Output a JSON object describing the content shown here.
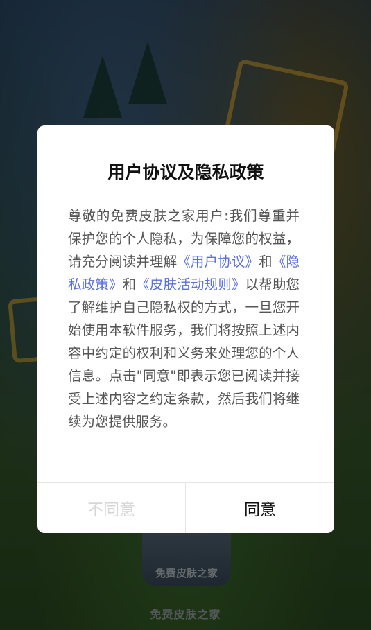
{
  "dialog": {
    "title": "用户协议及隐私政策",
    "body_parts": [
      "尊敬的免费皮肤之家用户:我们尊重并保护您的个人隐私，为保障您的权益，请充分阅读并理解",
      "《用户协议》",
      "和",
      "《隐私政策》",
      "和",
      "《皮肤活动规则》",
      "以帮助您了解维护自己隐私权的方式，一旦您开始使用本软件服务，我们将按照上述内容中约定的权利和义务来处理您的个人信息。点击\"同意\"即表示您已阅读并接受上述内容之约定条款，然后我们将继续为您提供服务。"
    ],
    "disagree_label": "不同意",
    "agree_label": "同意"
  },
  "background": {
    "logo_text": "免费皮肤之家",
    "app_name": "免费皮肤之家"
  },
  "colors": {
    "link": "#5a6fe0",
    "disabled_button_text": "#d6d6d6",
    "overlay": "rgba(0,0,0,0.45)"
  }
}
